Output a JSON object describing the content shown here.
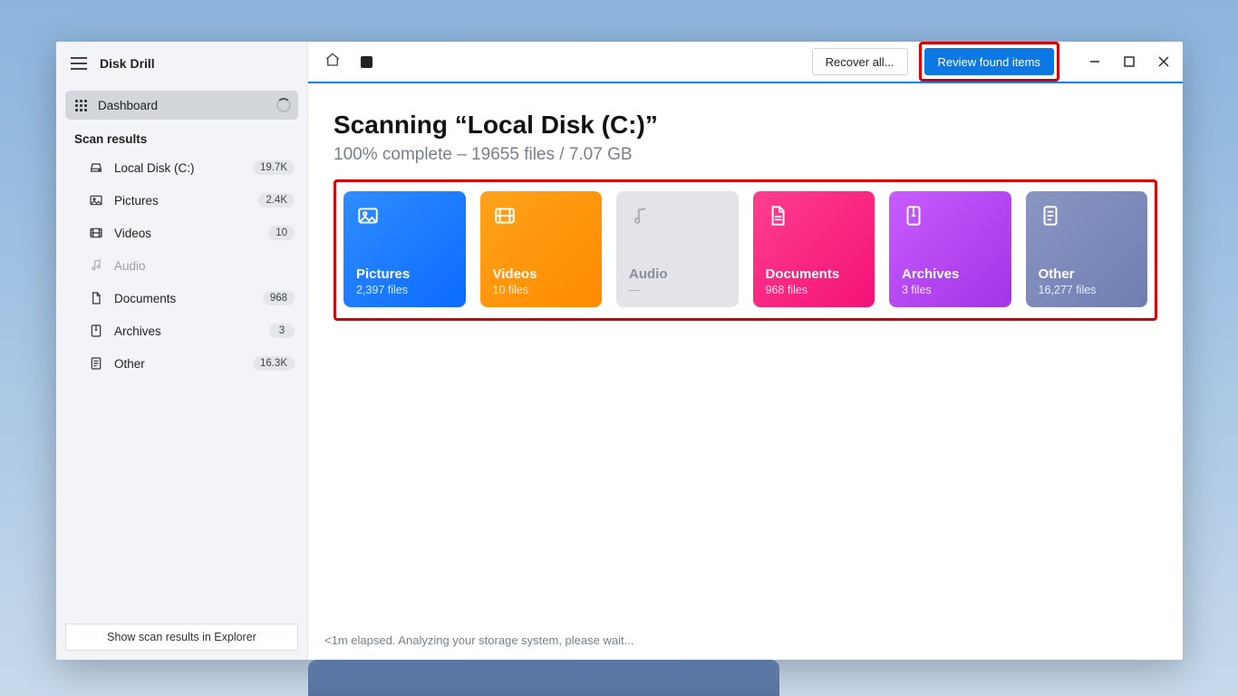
{
  "app_title": "Disk Drill",
  "sidebar": {
    "dashboard_label": "Dashboard",
    "section_title": "Scan results",
    "items": [
      {
        "label": "Local Disk (C:)",
        "count": "19.7K",
        "kind": "disk"
      },
      {
        "label": "Pictures",
        "count": "2.4K",
        "kind": "image"
      },
      {
        "label": "Videos",
        "count": "10",
        "kind": "video"
      },
      {
        "label": "Audio",
        "count": "",
        "kind": "audio",
        "muted": true
      },
      {
        "label": "Documents",
        "count": "968",
        "kind": "doc"
      },
      {
        "label": "Archives",
        "count": "3",
        "kind": "archive"
      },
      {
        "label": "Other",
        "count": "16.3K",
        "kind": "other"
      }
    ],
    "explorer_button": "Show scan results in Explorer"
  },
  "topbar": {
    "recover_button": "Recover all...",
    "review_button": "Review found items"
  },
  "main": {
    "title": "Scanning “Local Disk (C:)”",
    "subtitle": "100% complete – 19655 files / 7.07 GB",
    "status": "<1m elapsed. Analyzing your storage system, please wait..."
  },
  "cards": [
    {
      "label": "Pictures",
      "sub": "2,397 files",
      "style": "card-pictures",
      "icon": "image"
    },
    {
      "label": "Videos",
      "sub": "10 files",
      "style": "card-videos",
      "icon": "video"
    },
    {
      "label": "Audio",
      "sub": "—",
      "style": "card-audio",
      "icon": "audio",
      "muted": true
    },
    {
      "label": "Documents",
      "sub": "968 files",
      "style": "card-docs",
      "icon": "doc"
    },
    {
      "label": "Archives",
      "sub": "3 files",
      "style": "card-arch",
      "icon": "archive"
    },
    {
      "label": "Other",
      "sub": "16,277 files",
      "style": "card-other",
      "icon": "other"
    }
  ]
}
